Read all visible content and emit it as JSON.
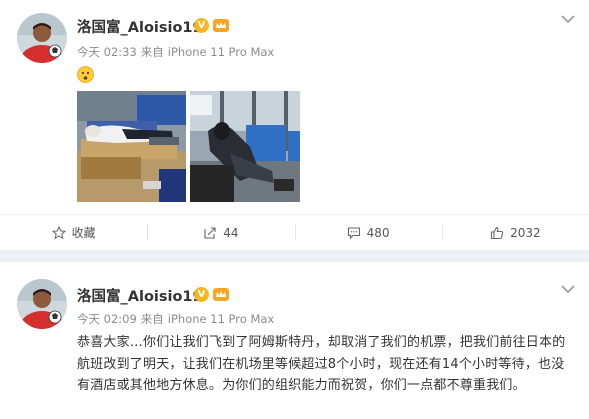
{
  "posts": [
    {
      "username": "洛国富_Aloisio19",
      "verified_badge": "V",
      "time": "今天 02:33",
      "source_prefix": "来自",
      "device": "iPhone 11 Pro Max",
      "emoji_icon": "sad-face-emoji",
      "images": [
        "photo-sleeping-on-bench",
        "photo-sleeping-on-airport-seats"
      ],
      "actions": {
        "favorite": "收藏",
        "repost": "44",
        "comment": "480",
        "like": "2032"
      }
    },
    {
      "username": "洛国富_Aloisio19",
      "verified_badge": "V",
      "time": "今天 02:09",
      "source_prefix": "来自",
      "device": "iPhone 11 Pro Max",
      "text": "恭喜大家…你们让我们飞到了阿姆斯特丹，却取消了我们的机票，把我们前往日本的航班改到了明天，让我们在机场里等候超过8个小时，现在还有14个小时等待，也没有酒店或其他地方休息。为你们的组织能力而祝贺，你们一点都不尊重我们。"
    }
  ],
  "colors": {
    "badge_gold": "#f6b620",
    "separator": "#eaf0f4",
    "meta_gray": "#8c8c8c"
  }
}
